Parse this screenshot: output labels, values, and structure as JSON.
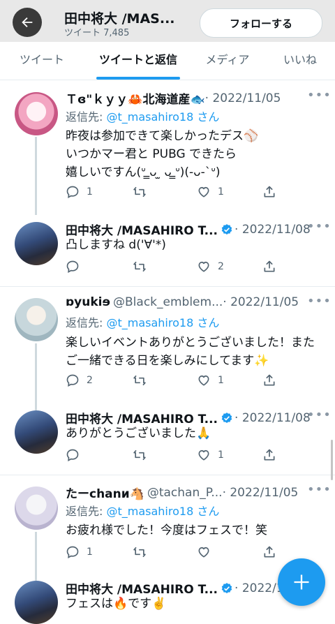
{
  "header": {
    "title": "田中将大 /MAS...",
    "subtitle": "ツイート 7,485",
    "follow_label": "フォローする",
    "bg_color": "#e8e8e8"
  },
  "tabs": [
    {
      "label": "ツイート",
      "active": false
    },
    {
      "label": "ツイートと返信",
      "active": true
    },
    {
      "label": "メディア",
      "active": false
    },
    {
      "label": "いいね",
      "active": false
    }
  ],
  "accent_color": "#1d9bf0",
  "tweets": [
    {
      "name": "Ｔɞ\"ｋｙｙ🦀北海道産🐟",
      "handle": "",
      "date": "· 2022/11/05",
      "verified": false,
      "reply_to_prefix": "返信先: ",
      "reply_to_mention": "@t_masahiro18 さん",
      "lines": [
        "昨夜は参加できて楽しかったデス⚾️",
        "いつかマー君と PUBG できたら",
        "嬉しいですん(ᐡ ̳ᴗ  ̫ ᴗ ̳ᐡ)(-ᴗ-`ᐡ)"
      ],
      "replies": "1",
      "retweets": "",
      "likes": "1",
      "avatar": "idol-illustration"
    },
    {
      "name": "田中将大 /MASAHIRO T...",
      "handle": "",
      "date": "· 2022/11/08",
      "verified": true,
      "lines": [
        "凸しますね d('∀'*)"
      ],
      "replies": "",
      "retweets": "",
      "likes": "2",
      "avatar": "baseball-player"
    },
    {
      "name": "ɒyukiɘ",
      "handle": "@Black_emblem...",
      "date": "· 2022/11/05",
      "verified": false,
      "reply_to_prefix": "返信先: ",
      "reply_to_mention": "@t_masahiro18 さん",
      "lines": [
        "楽しいイベントありがとうございました！また",
        "ご一緒できる日を楽しみにしてます✨"
      ],
      "replies": "2",
      "retweets": "",
      "likes": "1",
      "avatar": "anime-girl"
    },
    {
      "name": "田中将大 /MASAHIRO T...",
      "handle": "",
      "date": "· 2022/11/08",
      "verified": true,
      "lines": [
        "ありがとうございました🙏"
      ],
      "replies": "",
      "retweets": "",
      "likes": "1",
      "avatar": "baseball-player"
    },
    {
      "name": "たーchanᴎ🐴",
      "handle": "@tachan_P...",
      "date": "· 2022/11/05",
      "verified": false,
      "reply_to_prefix": "返信先: ",
      "reply_to_mention": "@t_masahiro18 さん",
      "lines": [
        "お疲れ様でした！今度はフェスで！笑"
      ],
      "replies": "1",
      "retweets": "",
      "likes": "",
      "avatar": "white-haired-character"
    },
    {
      "name": "田中将大 /MASAHIRO T...",
      "handle": "",
      "date": "· 2022/11/08",
      "verified": true,
      "lines": [
        "フェスは🔥です✌️"
      ],
      "avatar": "baseball-player"
    }
  ]
}
